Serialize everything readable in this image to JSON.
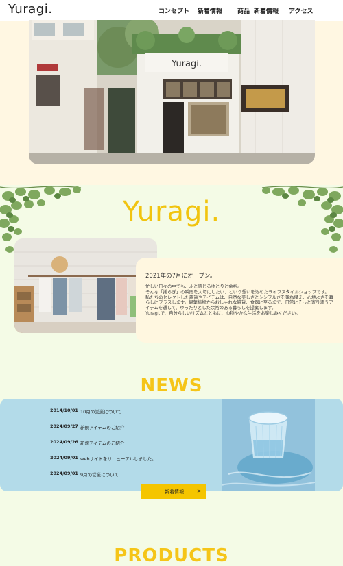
{
  "header": {
    "logo": "Yuragi.",
    "nav": [
      "コンセプト",
      "新着情報",
      "商品",
      "新着情報",
      "アクセス"
    ]
  },
  "hero": {
    "shop_sign": "Yuragi."
  },
  "about": {
    "brand": "Yuragi.",
    "heading": "2021年の7月にオープン。",
    "paragraphs": [
      "忙しい日々の中でも、ふと感じるゆとりと余裕。",
      "そんな「揺らぎ」の瞬間を大切にしたい、という想いを込めたライフスタイルショップです。",
      "私たちのセレクトした雑貨やアイテムは、自然な美しさとシンプルさを兼ね備え、心地よさを暮らしにプラスします。観葉植物からおしゃれな雑貨、食器に至るまで、日常にそっと寄り添うアイテムを通して、ゆったりとした余裕のある暮らしを提案します。",
      "Yuragi.で、自分らしいリズムとともに、心穏やかな生活をお楽しみください。"
    ]
  },
  "news": {
    "title": "NEWS",
    "items": [
      {
        "date": "2014/10/01",
        "text": "10月の営業について"
      },
      {
        "date": "2024/09/27",
        "text": "新規アイテムのご紹介"
      },
      {
        "date": "2024/09/26",
        "text": "新規アイテムのご紹介"
      },
      {
        "date": "2024/09/01",
        "text": "webサイトをリニューアルしました。"
      },
      {
        "date": "2024/09/01",
        "text": "9月の営業について"
      }
    ],
    "button_label": "新着情報",
    "button_arrow": ">"
  },
  "products": {
    "title": "PRODUCTS"
  },
  "colors": {
    "accent": "#f5c518",
    "page_bg": "#f4fbe6",
    "hero_bg": "#fff7e2",
    "news_panel": "#b3dbe9"
  }
}
